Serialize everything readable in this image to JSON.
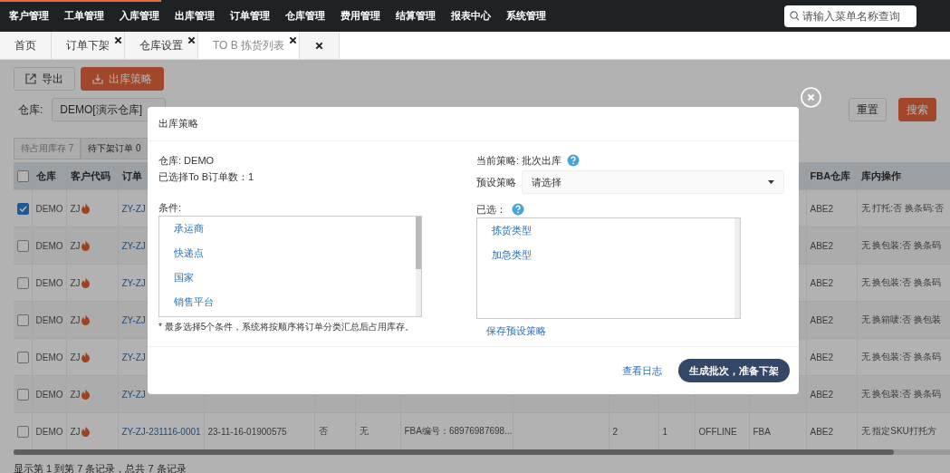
{
  "loading_bar": {
    "level": 0.17
  },
  "nav": {
    "items": [
      "客户管理",
      "工单管理",
      "入库管理",
      "出库管理",
      "订单管理",
      "仓库管理",
      "费用管理",
      "结算管理",
      "报表中心",
      "系统管理"
    ],
    "search": {
      "placeholder": "请输入菜单名称查询"
    }
  },
  "tabs": [
    {
      "kind": "page",
      "label": "首页",
      "closable": false,
      "selected": false
    },
    {
      "kind": "page",
      "label": "订单下架",
      "closable": true,
      "selected": false
    },
    {
      "kind": "page",
      "label": "仓库设置",
      "closable": true,
      "selected": false
    },
    {
      "kind": "page",
      "label": "TO B 拣货列表",
      "closable": true,
      "selected": true
    },
    {
      "kind": "close-all"
    }
  ],
  "toolbar": [
    {
      "kind": "default",
      "label": "导出"
    },
    {
      "kind": "primary",
      "label": "出库策略"
    }
  ],
  "filters": {
    "warehouse_label": "仓库:",
    "warehouse_value": "DEMO[演示仓库]",
    "reset": "重置",
    "search": "搜索"
  },
  "status_tabs": [
    {
      "label": "待占用库存 7",
      "selected": true
    },
    {
      "label": "待下架订单 0",
      "selected": false
    }
  ],
  "table": {
    "select_all": {
      "checked": false
    },
    "columns": {
      "warehouse": "仓库",
      "customer": "客户代码",
      "order": "订单",
      "fba_warehouse": "FBA仓库",
      "operation": "库内操作"
    },
    "rows": [
      {
        "checked": true,
        "warehouse": "DEMO",
        "customer": "ZJ",
        "hot": true,
        "order": "ZY-ZJ",
        "fba_warehouse": "ABE2",
        "operation": "无 打托:否 换条码:否"
      },
      {
        "checked": false,
        "warehouse": "DEMO",
        "customer": "ZJ",
        "hot": true,
        "order": "ZY-ZJ",
        "fba_warehouse": "ABE2",
        "operation": "无 换包装:否 换条码"
      },
      {
        "checked": false,
        "warehouse": "DEMO",
        "customer": "ZJ",
        "hot": true,
        "order": "ZY-ZJ",
        "fba_warehouse": "ABE2",
        "operation": "无 换包装:否 换条码"
      },
      {
        "checked": false,
        "warehouse": "DEMO",
        "customer": "ZJ",
        "hot": true,
        "order": "ZY-ZJ",
        "fba_warehouse": "ABE2",
        "operation": "无 换箱唛:否 换包装"
      },
      {
        "checked": false,
        "warehouse": "DEMO",
        "customer": "ZJ",
        "hot": true,
        "order": "ZY-ZJ",
        "fba_warehouse": "ABE2",
        "operation": "无 换包装:否 换条码"
      },
      {
        "checked": false,
        "warehouse": "DEMO",
        "customer": "ZJ",
        "hot": true,
        "order": "ZY-ZJ",
        "fba_warehouse": "ABE2",
        "operation": "无 换包装:否 换条码"
      },
      {
        "checked": false,
        "warehouse": "DEMO",
        "customer": "ZJ",
        "hot": true,
        "order": "ZY-ZJ-231116-0001",
        "column_5": "23-11-16-01900575",
        "column_6": "否",
        "column_7": "无",
        "column_8": "FBA编号：68976987698...",
        "column_10": "2",
        "column_11": "1",
        "column_12": "OFFLINE",
        "column_13": "FBA",
        "fba_warehouse": "ABE2",
        "operation": "无 指定SKU打托方"
      }
    ]
  },
  "footer": "显示第 1 到第 7 条记录，总共 7 条记录",
  "modal": {
    "title": "出库策略",
    "warehouse": "仓库: DEMO",
    "selected_count": "已选择To B订单数：1",
    "conditions_label": "条件:",
    "conditions": [
      "承运商",
      "快递点",
      "国家",
      "销售平台"
    ],
    "note": "* 最多选择5个条件，系统将按顺序将订单分类汇总后占用库存。",
    "current_strategy": "当前策略: 批次出库",
    "preset_label": "预设策略",
    "preset_placeholder": "请选择",
    "chosen_label": "已选：",
    "chosen": [
      "拣货类型",
      "加急类型"
    ],
    "save_preset": "保存预设策略",
    "log_link": "查看日志",
    "submit": "生成批次，准备下架"
  }
}
